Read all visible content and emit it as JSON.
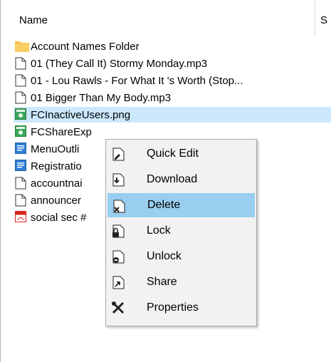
{
  "header": {
    "name_label": "Name",
    "next_label": "S"
  },
  "files": [
    {
      "name": "Account Names Folder",
      "icon": "folder-icon",
      "selected": false
    },
    {
      "name": "01 (They Call It) Stormy Monday.mp3",
      "icon": "file-icon",
      "selected": false
    },
    {
      "name": "01 - Lou Rawls - For What It 's Worth (Stop...",
      "icon": "file-icon",
      "selected": false
    },
    {
      "name": "01 Bigger Than My Body.mp3",
      "icon": "file-icon",
      "selected": false
    },
    {
      "name": "FCInactiveUsers.png",
      "icon": "image-file-icon",
      "selected": true
    },
    {
      "name": "FCShareExp",
      "icon": "image-file-icon",
      "selected": false
    },
    {
      "name": "MenuOutli",
      "icon": "document-file-icon",
      "selected": false
    },
    {
      "name": "Registratio",
      "icon": "document-file-icon",
      "selected": false
    },
    {
      "name": "accountnai",
      "icon": "file-icon",
      "selected": false
    },
    {
      "name": "announcer",
      "icon": "file-icon",
      "selected": false
    },
    {
      "name": "social sec #",
      "icon": "pdf-file-icon",
      "selected": false
    }
  ],
  "context_menu": {
    "items": [
      {
        "label": "Quick Edit",
        "icon": "quick-edit-icon",
        "active": false
      },
      {
        "label": "Download",
        "icon": "download-icon",
        "active": false
      },
      {
        "label": "Delete",
        "icon": "delete-icon",
        "active": true
      },
      {
        "label": "Lock",
        "icon": "lock-icon",
        "active": false
      },
      {
        "label": "Unlock",
        "icon": "unlock-icon",
        "active": false
      },
      {
        "label": "Share",
        "icon": "share-icon",
        "active": false
      },
      {
        "label": "Properties",
        "icon": "properties-icon",
        "active": false
      }
    ]
  },
  "colors": {
    "selection": "#cce8ff",
    "menu_highlight": "#99cef0",
    "folder": "#f7c34f",
    "image_icon": "#3aa657",
    "doc_icon": "#2f7ed8",
    "pdf_icon": "#d9261c"
  }
}
